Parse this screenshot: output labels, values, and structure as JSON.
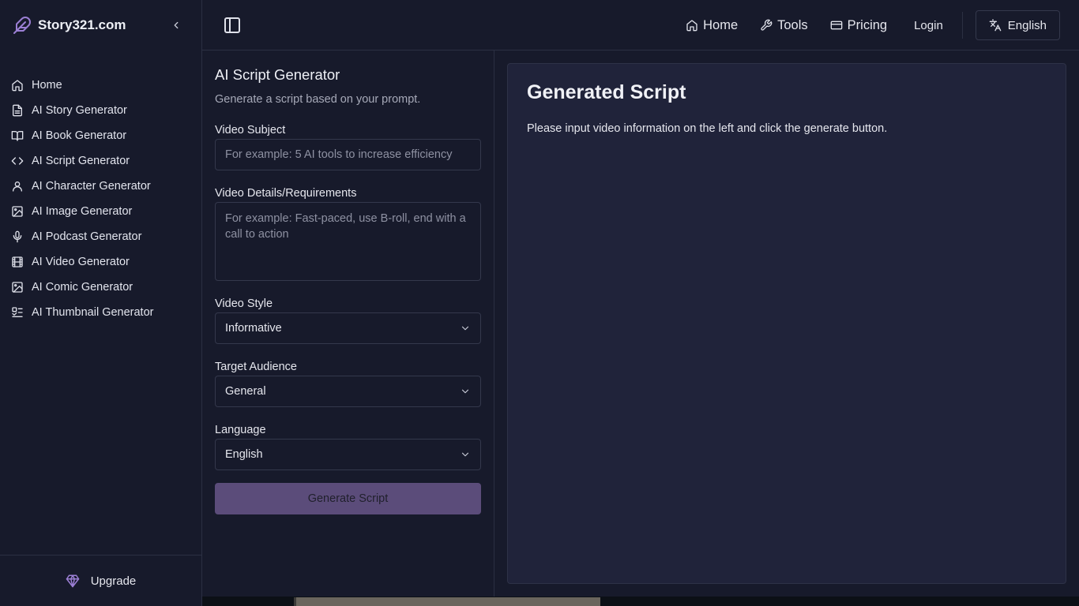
{
  "brand": {
    "name": "Story321.com"
  },
  "sidebar": {
    "items": [
      {
        "label": "Home",
        "icon": "home-icon"
      },
      {
        "label": "AI Story Generator",
        "icon": "file-text-icon"
      },
      {
        "label": "AI Book Generator",
        "icon": "book-open-icon"
      },
      {
        "label": "AI Script Generator",
        "icon": "code-icon"
      },
      {
        "label": "AI Character Generator",
        "icon": "user-icon"
      },
      {
        "label": "AI Image Generator",
        "icon": "image-icon"
      },
      {
        "label": "AI Podcast Generator",
        "icon": "mic-icon"
      },
      {
        "label": "AI Video Generator",
        "icon": "film-icon"
      },
      {
        "label": "AI Comic Generator",
        "icon": "image-icon"
      },
      {
        "label": "AI Thumbnail Generator",
        "icon": "thumbnail-icon"
      }
    ],
    "upgrade_label": "Upgrade"
  },
  "header": {
    "nav": {
      "home": "Home",
      "tools": "Tools",
      "pricing": "Pricing"
    },
    "login": "Login",
    "language": "English"
  },
  "form": {
    "title": "AI Script Generator",
    "subtitle": "Generate a script based on your prompt.",
    "subject_label": "Video Subject",
    "subject_placeholder": "For example: 5 AI tools to increase efficiency",
    "details_label": "Video Details/Requirements",
    "details_placeholder": "For example: Fast-paced, use B-roll, end with a call to action",
    "style_label": "Video Style",
    "style_value": "Informative",
    "audience_label": "Target Audience",
    "audience_value": "General",
    "language_label": "Language",
    "language_value": "English",
    "generate_label": "Generate Script"
  },
  "output": {
    "title": "Generated Script",
    "message": "Please input video information on the left and click the generate button."
  },
  "colors": {
    "background": "#171a2b",
    "panel": "#20233a",
    "accent": "#9b7fd4",
    "button": "#5b4c7a"
  }
}
